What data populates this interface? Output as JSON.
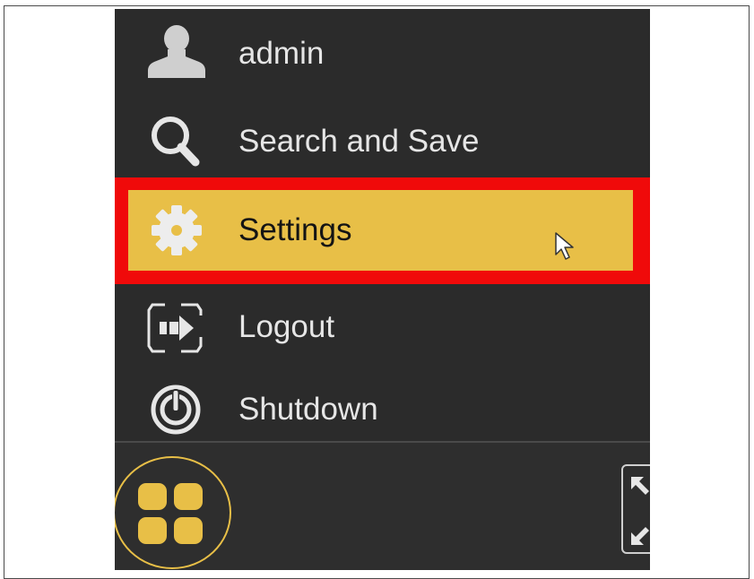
{
  "menu": {
    "items": [
      {
        "label": "admin",
        "icon": "user-icon"
      },
      {
        "label": "Search and Save",
        "icon": "search-icon"
      },
      {
        "label": "Settings",
        "icon": "gear-icon",
        "highlighted": true
      },
      {
        "label": "Logout",
        "icon": "logout-icon"
      },
      {
        "label": "Shutdown",
        "icon": "power-icon"
      }
    ]
  },
  "bottom_bar": {
    "grid_icon": "grid-icon",
    "expand_icon": "expand-icon"
  },
  "colors": {
    "panel_background": "#2b2b2b",
    "menu_text": "#e6e6e6",
    "highlight_fill": "#e8bf47",
    "highlight_outline": "#f00a0a",
    "accent": "#e8bf47"
  }
}
